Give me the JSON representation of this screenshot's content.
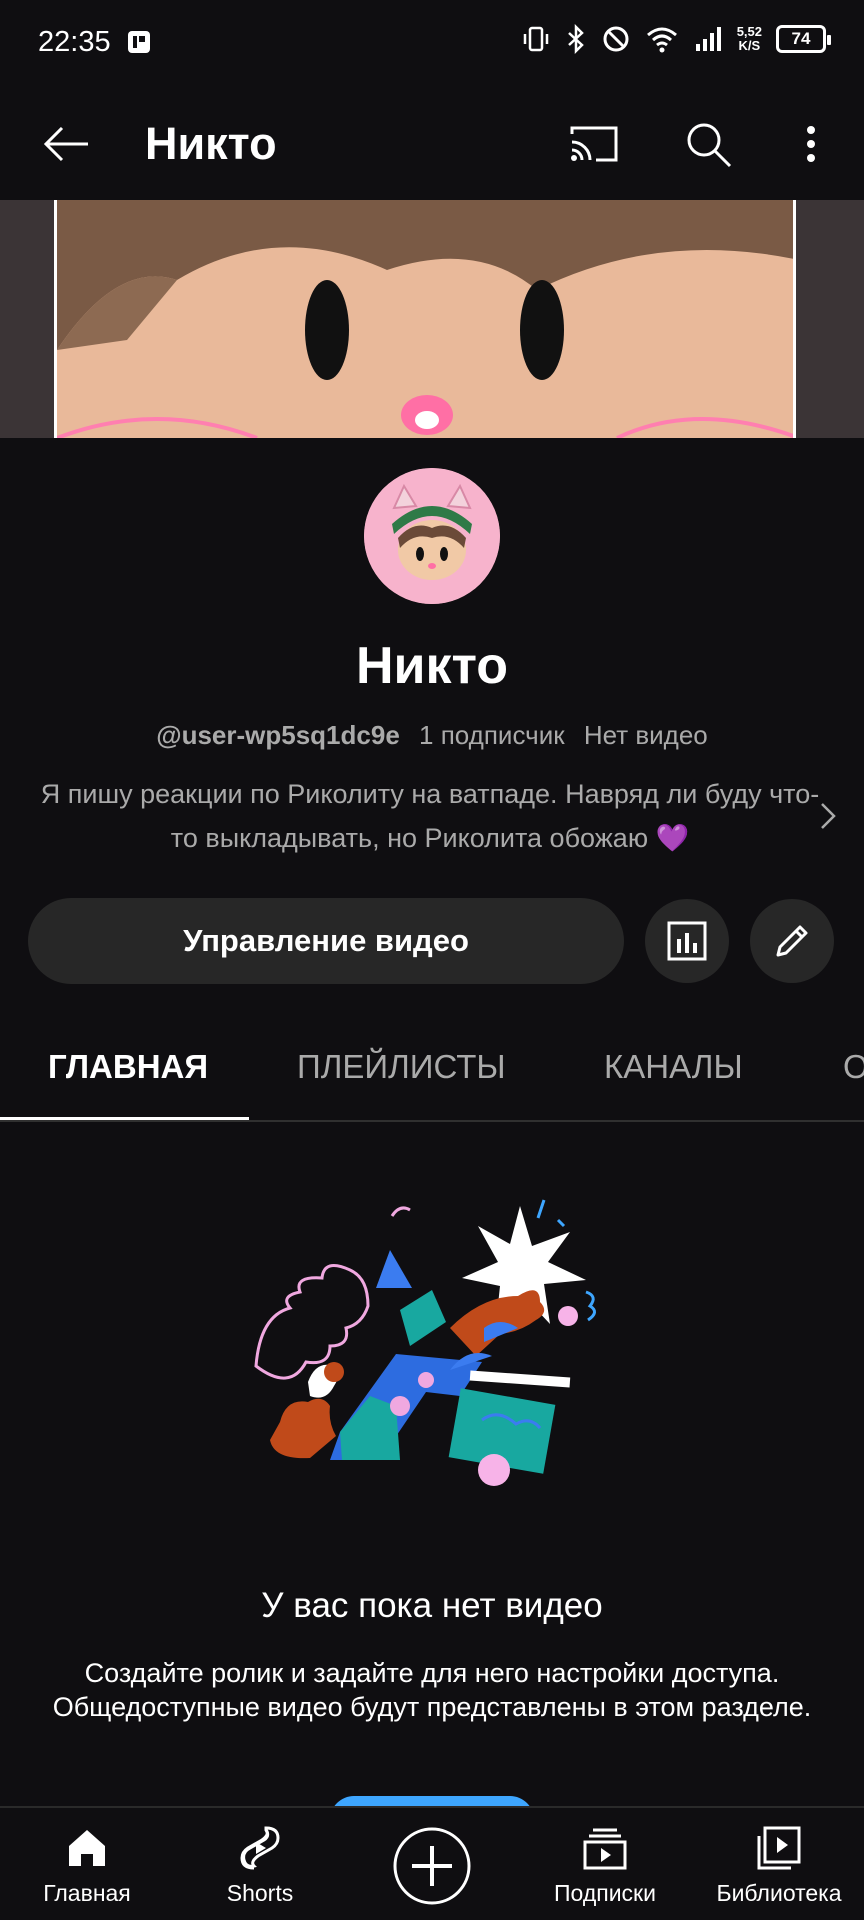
{
  "status_bar": {
    "time": "22:35",
    "net_speed_value": "5,52",
    "net_speed_unit": "K/S",
    "battery": "74"
  },
  "app_bar": {
    "title": "Никто"
  },
  "channel": {
    "name": "Никто",
    "handle": "@user-wp5sq1dc9e",
    "subscribers": "1 подписчик",
    "videos": "Нет видео",
    "description": "Я пишу реакции по Риколиту на ватпаде. Навряд ли буду что-то выкладывать, но Риколита обожаю 💜"
  },
  "actions": {
    "manage_label": "Управление видео"
  },
  "tabs": [
    {
      "label": "ГЛАВНАЯ",
      "active": true
    },
    {
      "label": "ПЛЕЙЛИСТЫ",
      "active": false
    },
    {
      "label": "КАНАЛЫ",
      "active": false
    },
    {
      "label": "О КАНАЛЕ",
      "active": false
    }
  ],
  "empty_state": {
    "title": "У вас пока нет видео",
    "text": "Создайте ролик и задайте для него настройки доступа. Общедоступные видео будут представлены в этом разделе."
  },
  "bottom_nav": {
    "home": "Главная",
    "shorts": "Shorts",
    "subscriptions": "Подписки",
    "library": "Библиотека"
  },
  "colors": {
    "background": "#0f0e11",
    "surface": "#272727",
    "secondary_text": "#aaaaaa",
    "accent_blue": "#3ea6ff"
  }
}
